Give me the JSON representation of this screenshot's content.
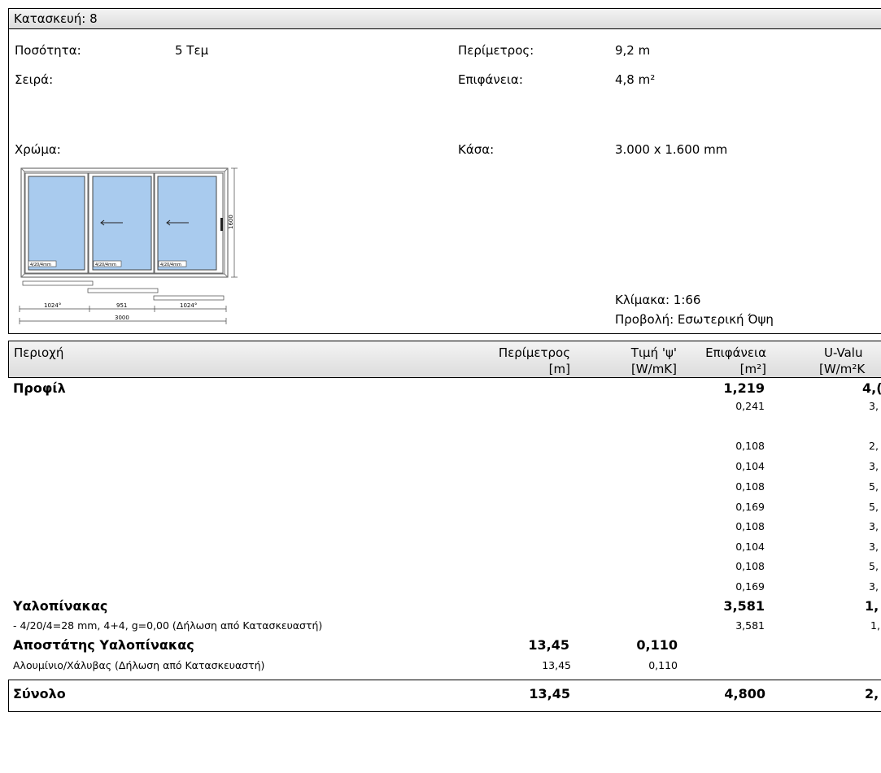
{
  "construction": {
    "title": "Κατασκευή: 8",
    "qty_label": "Ποσότητα:",
    "qty_value": "5 Τεμ",
    "series_label": "Σειρά:",
    "color_label": "Χρώμα:",
    "perimeter_label": "Περίμετρος:",
    "perimeter_value": "9,2 m",
    "area_label": "Επιφάνεια:",
    "area_value": "4,8 m²",
    "frame_label": "Κάσα:",
    "frame_value": "3.000 x 1.600 mm",
    "scale": "Κλίμακα: 1:66",
    "view": "Προβολή: Εσωτερική Όψη"
  },
  "drawing": {
    "height_dim": "1600",
    "pane_label": "4/20/4mm",
    "widths": [
      "1024°",
      "951",
      "1024°"
    ],
    "total_width": "3000",
    "glass_color": "#a9cbee"
  },
  "table": {
    "headers": {
      "region": "Περιοχή",
      "perimeter": "Περίμετρος",
      "perimeter_unit": "[m]",
      "psi": "Τιμή 'ψ'",
      "psi_unit": "[W/mK]",
      "area": "Επιφάνεια",
      "area_unit": "[m²]",
      "uvalue": "U-Valu",
      "uvalue_unit": "[W/m²K"
    },
    "profile": {
      "label": "Προφίλ",
      "area": "1,219",
      "u": "4,("
    },
    "profile_rows": [
      {
        "area": "0,241",
        "u": "3,"
      },
      {
        "area": "0,108",
        "u": "2,"
      },
      {
        "area": "0,104",
        "u": "3,"
      },
      {
        "area": "0,108",
        "u": "5,"
      },
      {
        "area": "0,169",
        "u": "5,"
      },
      {
        "area": "0,108",
        "u": "3,"
      },
      {
        "area": "0,104",
        "u": "3,"
      },
      {
        "area": "0,108",
        "u": "5,"
      },
      {
        "area": "0,169",
        "u": "3,"
      }
    ],
    "glass": {
      "label": "Υαλοπίνακας",
      "area": "3,581",
      "u": "1,",
      "detail": "- 4/20/4=28 mm, 4+4, g=0,00 (Δήλωση από Κατασκευαστή)",
      "detail_area": "3,581",
      "detail_u": "1,"
    },
    "spacer": {
      "label": "Αποστάτης Υαλοπίνακας",
      "perimeter": "13,45",
      "psi": "0,110",
      "detail": "Αλουμίνιο/Χάλυβας (Δήλωση από Κατασκευαστή)",
      "detail_perimeter": "13,45",
      "detail_psi": "0,110"
    },
    "total": {
      "label": "Σύνολο",
      "perimeter": "13,45",
      "area": "4,800",
      "u": "2,"
    }
  }
}
